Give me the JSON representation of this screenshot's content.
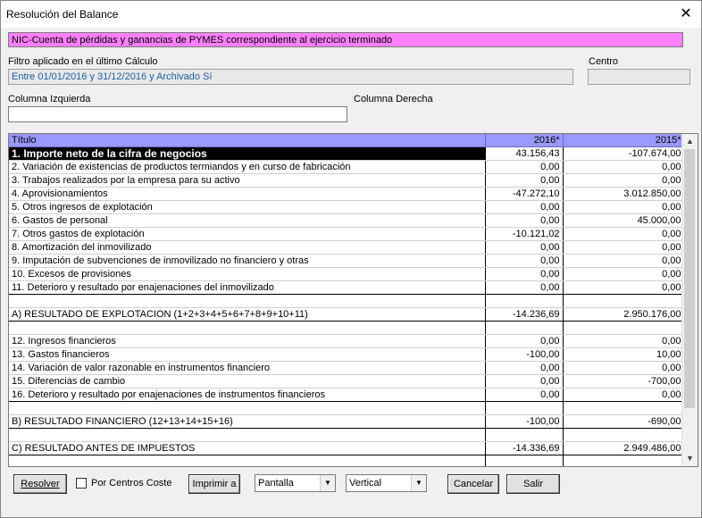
{
  "window": {
    "title": "Resolución del Balance"
  },
  "report_name": "NIC-Cuenta de pérdidas y ganancias de PYMES correspondiente al ejercicio terminado",
  "filter": {
    "label": "Filtro aplicado en el último Cálculo",
    "value": "Entre 01/01/2016 y 31/12/2016 y Archivado Sí"
  },
  "centro": {
    "label": "Centro",
    "value": ""
  },
  "columna_izquierda": {
    "label": "Columna Izquierda",
    "value": ""
  },
  "columna_derecha": {
    "label": "Columna Derecha"
  },
  "grid": {
    "headers": {
      "title": "Título",
      "col1": "2016*",
      "col2": "2015*"
    },
    "rows": [
      {
        "title": "1. Importe neto de la cifra de negocios",
        "v1": "43.156,43",
        "v2": "-107.674,00"
      },
      {
        "title": "2. Variación de existencias de productos termiandos y en curso de fabricación",
        "v1": "0,00",
        "v2": "0,00"
      },
      {
        "title": "3. Trabajos realizados por la empresa para su activo",
        "v1": "0,00",
        "v2": "0,00"
      },
      {
        "title": "4. Aprovisionamientos",
        "v1": "-47.272,10",
        "v2": "3.012.850,00"
      },
      {
        "title": "5. Otros ingresos de explotación",
        "v1": "0,00",
        "v2": "0,00"
      },
      {
        "title": "6. Gastos de personal",
        "v1": "0,00",
        "v2": "45.000,00"
      },
      {
        "title": "7. Otros gastos de explotación",
        "v1": "-10.121,02",
        "v2": "0,00"
      },
      {
        "title": "8. Amortización del inmovilizado",
        "v1": "0,00",
        "v2": "0,00"
      },
      {
        "title": "9. Imputación de subvenciones de inmovilizado no financiero y otras",
        "v1": "0,00",
        "v2": "0,00"
      },
      {
        "title": "10. Excesos de provisiones",
        "v1": "0,00",
        "v2": "0,00"
      },
      {
        "title": "11. Deterioro y resultado por enajenaciones del inmovilizado",
        "v1": "0,00",
        "v2": "0,00"
      },
      {
        "title": "",
        "v1": "",
        "v2": ""
      },
      {
        "title": "A) RESULTADO DE EXPLOTACION (1+2+3+4+5+6+7+8+9+10+11)",
        "v1": "-14.236,69",
        "v2": "2.950.176,00"
      },
      {
        "title": "",
        "v1": "",
        "v2": ""
      },
      {
        "title": "12. Ingresos financieros",
        "v1": "0,00",
        "v2": "0,00"
      },
      {
        "title": "13. Gastos financieros",
        "v1": "-100,00",
        "v2": "10,00"
      },
      {
        "title": "14. Variación de valor razonable en instrumentos financiero",
        "v1": "0,00",
        "v2": "0,00"
      },
      {
        "title": "15. Diferencias de cambio",
        "v1": "0,00",
        "v2": "-700,00"
      },
      {
        "title": "16. Deterioro y resultado por enajenaciones de instrumentos financieros",
        "v1": "0,00",
        "v2": "0,00"
      },
      {
        "title": "",
        "v1": "",
        "v2": ""
      },
      {
        "title": "B) RESULTADO FINANCIERO (12+13+14+15+16)",
        "v1": "-100,00",
        "v2": "-690,00"
      },
      {
        "title": "",
        "v1": "",
        "v2": ""
      },
      {
        "title": "C) RESULTADO ANTES DE IMPUESTOS",
        "v1": "-14.336,69",
        "v2": "2.949.486,00"
      },
      {
        "title": "",
        "v1": "",
        "v2": ""
      }
    ]
  },
  "buttons": {
    "resolver": "Resolver",
    "por_centros": "Por Centros Coste",
    "imprimir": "Imprimir a",
    "pantalla": "Pantalla",
    "vertical": "Vertical",
    "cancelar": "Cancelar",
    "salir": "Salir"
  }
}
